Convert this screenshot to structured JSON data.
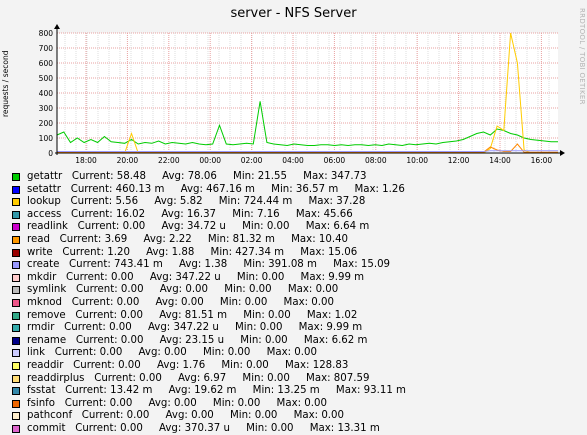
{
  "graph": {
    "title": "server - NFS Server",
    "y_axis_label": "requests / second",
    "watermark": "RRDTOOL / TOBI OETIKER"
  },
  "chart_data": {
    "type": "line",
    "title": "server - NFS Server",
    "ylabel": "requests / second",
    "ylim": [
      0,
      800
    ],
    "y_ticks": [
      "0",
      "100",
      "200",
      "300",
      "400",
      "500",
      "600",
      "700",
      "800"
    ],
    "x_ticks": [
      "18:00",
      "20:00",
      "22:00",
      "00:00",
      "02:00",
      "04:00",
      "06:00",
      "08:00",
      "10:00",
      "12:00",
      "14:00",
      "16:00"
    ],
    "grid": true,
    "series": [
      {
        "name": "getattr",
        "color": "#00cc00",
        "values": [
          120,
          140,
          70,
          100,
          70,
          90,
          70,
          110,
          75,
          70,
          65,
          90,
          60,
          70,
          65,
          80,
          60,
          70,
          65,
          60,
          70,
          60,
          55,
          60,
          185,
          60,
          55,
          60,
          65,
          60,
          345,
          70,
          60,
          55,
          50,
          60,
          55,
          50,
          50,
          55,
          55,
          50,
          55,
          50,
          55,
          55,
          50,
          55,
          50,
          60,
          55,
          50,
          60,
          55,
          60,
          65,
          60,
          70,
          75,
          80,
          90,
          110,
          130,
          140,
          120,
          160,
          150,
          130,
          120,
          100,
          90,
          85,
          80,
          75,
          75
        ]
      },
      {
        "name": "lookup",
        "color": "#ffcc00",
        "values": [
          0,
          0,
          0,
          0,
          0,
          0,
          0,
          0,
          0,
          0,
          0,
          130,
          0,
          0,
          0,
          0,
          0,
          0,
          0,
          0,
          0,
          0,
          0,
          0,
          0,
          0,
          0,
          0,
          0,
          0,
          0,
          0,
          0,
          0,
          0,
          0,
          0,
          0,
          0,
          0,
          0,
          0,
          0,
          0,
          0,
          0,
          0,
          0,
          0,
          0,
          0,
          0,
          0,
          0,
          0,
          0,
          0,
          0,
          0,
          0,
          0,
          0,
          0,
          0,
          30,
          180,
          150,
          800,
          600,
          20,
          0,
          0,
          0,
          0,
          0
        ]
      },
      {
        "name": "read",
        "color": "#ff8800",
        "values": [
          5,
          5,
          5,
          5,
          5,
          5,
          5,
          5,
          5,
          5,
          5,
          5,
          5,
          5,
          5,
          5,
          5,
          5,
          5,
          5,
          5,
          5,
          5,
          5,
          5,
          5,
          5,
          5,
          5,
          5,
          5,
          5,
          5,
          5,
          5,
          5,
          5,
          5,
          5,
          5,
          5,
          5,
          5,
          5,
          5,
          5,
          5,
          5,
          5,
          5,
          5,
          5,
          5,
          5,
          5,
          5,
          5,
          5,
          5,
          5,
          5,
          5,
          5,
          5,
          40,
          20,
          10,
          10,
          60,
          5,
          5,
          5,
          5,
          5,
          5
        ]
      },
      {
        "name": "create",
        "color": "#9999ff",
        "values": [
          10,
          10,
          10,
          10,
          10,
          10,
          10,
          10,
          10,
          10,
          10,
          10,
          10,
          10,
          10,
          10,
          10,
          10,
          10,
          10,
          10,
          10,
          10,
          10,
          10,
          10,
          10,
          10,
          10,
          10,
          10,
          10,
          10,
          10,
          10,
          10,
          10,
          10,
          10,
          10,
          10,
          10,
          10,
          10,
          10,
          10,
          10,
          10,
          10,
          10,
          10,
          10,
          10,
          10,
          10,
          10,
          10,
          10,
          10,
          10,
          10,
          10,
          10,
          10,
          15,
          15,
          15,
          15,
          15,
          15,
          15,
          15,
          15,
          15,
          15
        ]
      }
    ]
  },
  "legend": [
    {
      "name": "getattr",
      "color": "#00cc00",
      "current": "58.48",
      "avg": "78.06",
      "min": "21.55",
      "max": "347.73"
    },
    {
      "name": "setattr",
      "color": "#0000ff",
      "current": "460.13 m",
      "avg": "467.16 m",
      "min": "36.57 m",
      "max": "1.26"
    },
    {
      "name": "lookup",
      "color": "#ffcc00",
      "current": "5.56",
      "avg": "5.82",
      "min": "724.44 m",
      "max": "37.28"
    },
    {
      "name": "access",
      "color": "#3399aa",
      "current": "16.02",
      "avg": "16.37",
      "min": "7.16",
      "max": "45.66"
    },
    {
      "name": "readlink",
      "color": "#cc00cc",
      "current": "0.00",
      "avg": "34.72 u",
      "min": "0.00",
      "max": "6.64 m"
    },
    {
      "name": "read",
      "color": "#ff9900",
      "current": "3.69",
      "avg": "2.22",
      "min": "81.32 m",
      "max": "10.40"
    },
    {
      "name": "write",
      "color": "#990000",
      "current": "1.20",
      "avg": "1.88",
      "min": "427.34 m",
      "max": "15.06"
    },
    {
      "name": "create",
      "color": "#9999ff",
      "current": "743.41 m",
      "avg": "1.38",
      "min": "391.08 m",
      "max": "15.09"
    },
    {
      "name": "mkdir",
      "color": "#ffcccc",
      "current": "0.00",
      "avg": "347.22 u",
      "min": "0.00",
      "max": "9.99 m"
    },
    {
      "name": "symlink",
      "color": "#bbbbbb",
      "current": "0.00",
      "avg": "0.00",
      "min": "0.00",
      "max": "0.00"
    },
    {
      "name": "mknod",
      "color": "#ee5588",
      "current": "0.00",
      "avg": "0.00",
      "min": "0.00",
      "max": "0.00"
    },
    {
      "name": "remove",
      "color": "#33aa88",
      "current": "0.00",
      "avg": "81.51 m",
      "min": "0.00",
      "max": "1.02"
    },
    {
      "name": "rmdir",
      "color": "#33aaaa",
      "current": "0.00",
      "avg": "347.22 u",
      "min": "0.00",
      "max": "9.99 m"
    },
    {
      "name": "rename",
      "color": "#000088",
      "current": "0.00",
      "avg": "23.15 u",
      "min": "0.00",
      "max": "6.62 m"
    },
    {
      "name": "link",
      "color": "#ccccff",
      "current": "0.00",
      "avg": "0.00",
      "min": "0.00",
      "max": "0.00"
    },
    {
      "name": "readdir",
      "color": "#ffff66",
      "current": "0.00",
      "avg": "1.76",
      "min": "0.00",
      "max": "128.83"
    },
    {
      "name": "readdirplus",
      "color": "#ffdd77",
      "current": "0.00",
      "avg": "6.97",
      "min": "0.00",
      "max": "807.59"
    },
    {
      "name": "fsstat",
      "color": "#3388aa",
      "current": "13.42 m",
      "avg": "19.62 m",
      "min": "13.25 m",
      "max": "93.11 m"
    },
    {
      "name": "fsinfo",
      "color": "#ee6600",
      "current": "0.00",
      "avg": "0.00",
      "min": "0.00",
      "max": "0.00"
    },
    {
      "name": "pathconf",
      "color": "#ffeecc",
      "current": "0.00",
      "avg": "0.00",
      "min": "0.00",
      "max": "0.00"
    },
    {
      "name": "commit",
      "color": "#dd66cc",
      "current": "0.00",
      "avg": "370.37 u",
      "min": "0.00",
      "max": "13.31 m"
    }
  ],
  "legend_labels": {
    "current": "Current:",
    "avg": "Avg:",
    "min": "Min:",
    "max": "Max:"
  }
}
